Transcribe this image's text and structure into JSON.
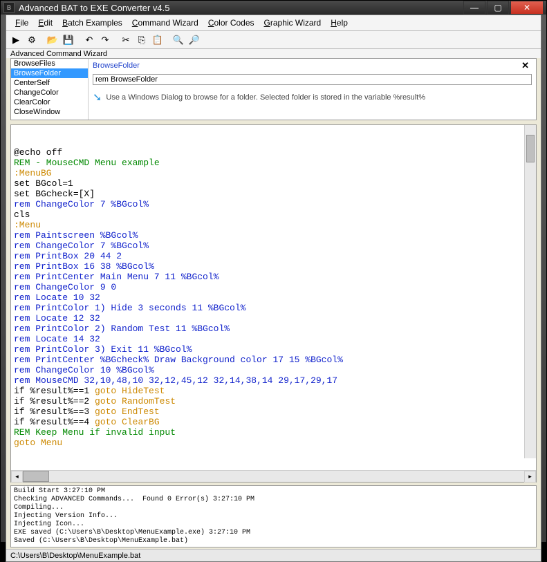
{
  "title": "Advanced BAT to EXE Converter v4.5",
  "menus": [
    "File",
    "Edit",
    "Batch Examples",
    "Command Wizard",
    "Color Codes",
    "Graphic Wizard",
    "Help"
  ],
  "toolbar_icons": [
    "play-icon",
    "gear-icon",
    "open-folder-icon",
    "save-icon",
    "undo-icon",
    "redo-icon",
    "cut-icon",
    "copy-icon",
    "paste-icon",
    "zoom-in-icon",
    "zoom-out-icon"
  ],
  "wizard_section_label": "Advanced Command Wizard",
  "cmdlist": [
    "BrowseFiles",
    "BrowseFolder",
    "CenterSelf",
    "ChangeColor",
    "ClearColor",
    "CloseWindow"
  ],
  "selected_cmd_index": 1,
  "wizard_cmdname": "BrowseFolder",
  "wizard_input_value": "rem BrowseFolder",
  "wizard_help": "Use a Windows Dialog to browse for a folder. Selected folder is stored in the variable %result%",
  "code": [
    {
      "c": "black",
      "t": "@echo off"
    },
    {
      "c": "green",
      "t": "REM - MouseCMD Menu example"
    },
    {
      "c": "yellow",
      "t": ":MenuBG"
    },
    {
      "c": "black",
      "t": "set BGcol=1"
    },
    {
      "c": "black",
      "t": "set BGcheck=[X]"
    },
    {
      "c": "blue",
      "t": "rem ChangeColor 7 %BGcol%"
    },
    {
      "c": "black",
      "t": "cls"
    },
    {
      "c": "yellow",
      "t": ":Menu"
    },
    {
      "c": "blue",
      "t": "rem Paintscreen %BGcol%"
    },
    {
      "c": "blue",
      "t": "rem ChangeColor 7 %BGcol%"
    },
    {
      "c": "blue",
      "t": "rem PrintBox 20 44 2"
    },
    {
      "c": "blue",
      "t": "rem PrintBox 16 38 %BGcol%"
    },
    {
      "c": "blue",
      "t": "rem PrintCenter Main Menu 7 11 %BGcol%"
    },
    {
      "c": "blue",
      "t": "rem ChangeColor 9 0"
    },
    {
      "c": "blue",
      "t": "rem Locate 10 32"
    },
    {
      "c": "blue",
      "t": "rem PrintColor 1) Hide 3 seconds 11 %BGcol%"
    },
    {
      "c": "blue",
      "t": "rem Locate 12 32"
    },
    {
      "c": "blue",
      "t": "rem PrintColor 2) Random Test 11 %BGcol%"
    },
    {
      "c": "blue",
      "t": "rem Locate 14 32"
    },
    {
      "c": "blue",
      "t": "rem PrintColor 3) Exit 11 %BGcol%"
    },
    {
      "c": "blue",
      "t": "rem PrintCenter %BGcheck% Draw Background color 17 15 %BGcol%"
    },
    {
      "c": "blue",
      "t": "rem ChangeColor 10 %BGcol%"
    },
    {
      "c": "blue",
      "t": "rem MouseCMD 32,10,48,10 32,12,45,12 32,14,38,14 29,17,29,17"
    },
    {
      "seg": [
        {
          "c": "black",
          "t": "if %result%==1 "
        },
        {
          "c": "yellow",
          "t": "goto HideTest"
        }
      ]
    },
    {
      "seg": [
        {
          "c": "black",
          "t": "if %result%==2 "
        },
        {
          "c": "yellow",
          "t": "goto RandomTest"
        }
      ]
    },
    {
      "seg": [
        {
          "c": "black",
          "t": "if %result%==3 "
        },
        {
          "c": "yellow",
          "t": "goto EndTest"
        }
      ]
    },
    {
      "seg": [
        {
          "c": "black",
          "t": "if %result%==4 "
        },
        {
          "c": "yellow",
          "t": "goto ClearBG"
        }
      ]
    },
    {
      "c": "green",
      "t": "REM Keep Menu if invalid input"
    },
    {
      "c": "yellow",
      "t": "goto Menu"
    }
  ],
  "console_lines": [
    "Build Start 3:27:10 PM",
    "Checking ADVANCED Commands...  Found 0 Error(s) 3:27:10 PM",
    "Compiling...",
    "Injecting Version Info...",
    "Injecting Icon...",
    "EXE saved (C:\\Users\\B\\Desktop\\MenuExample.exe) 3:27:10 PM",
    "Saved (C:\\Users\\B\\Desktop\\MenuExample.bat)"
  ],
  "status_path": "C:\\Users\\B\\Desktop\\MenuExample.bat",
  "glyphs": {
    "play-icon": "▶",
    "gear-icon": "⚙",
    "open-folder-icon": "📂",
    "save-icon": "💾",
    "undo-icon": "↶",
    "redo-icon": "↷",
    "cut-icon": "✂",
    "copy-icon": "⎘",
    "paste-icon": "📋",
    "zoom-in-icon": "🔍",
    "zoom-out-icon": "🔎"
  }
}
